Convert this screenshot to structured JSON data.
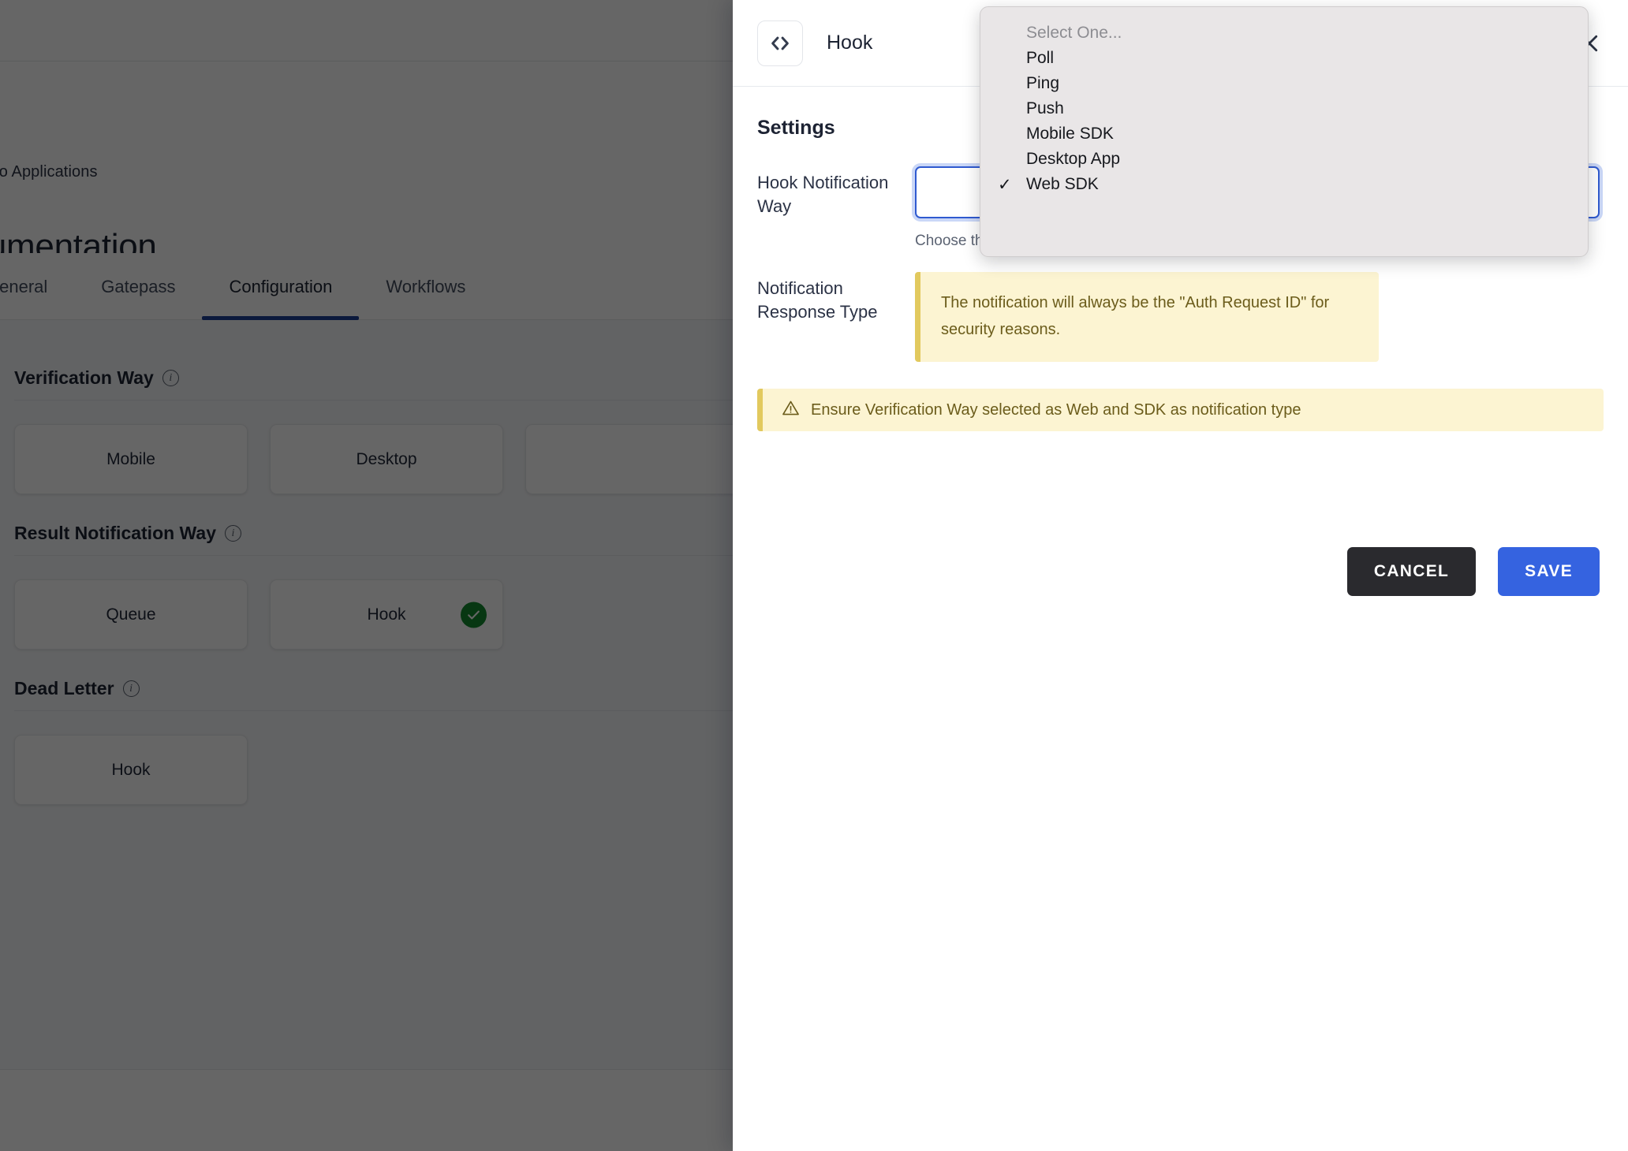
{
  "background": {
    "back_link": "ack to Applications",
    "app_title": "ocumentation",
    "tabs": [
      {
        "label": "General",
        "active": false
      },
      {
        "label": "Gatepass",
        "active": false
      },
      {
        "label": "Configuration",
        "active": true
      },
      {
        "label": "Workflows",
        "active": false
      }
    ],
    "sections": [
      {
        "title": "Verification Way",
        "info_icon": "info-icon",
        "options": [
          {
            "label": "Mobile",
            "selected": false
          },
          {
            "label": "Desktop",
            "selected": false
          },
          {
            "label": "",
            "selected": false
          }
        ]
      },
      {
        "title": "Result Notification Way",
        "info_icon": "info-icon",
        "options": [
          {
            "label": "Queue",
            "selected": false
          },
          {
            "label": "Hook",
            "selected": true
          }
        ]
      },
      {
        "title": "Dead Letter",
        "info_icon": "info-icon",
        "options": [
          {
            "label": "Hook",
            "selected": false
          }
        ]
      }
    ]
  },
  "panel": {
    "icon": "code-brackets-icon",
    "title": "Hook",
    "close_icon": "close-icon",
    "settings_heading": "Settings",
    "fields": [
      {
        "label": "Hook Notification Way",
        "control": "select",
        "value": "Web SDK",
        "help": "Choose the method for sharing the result through hook notifications."
      },
      {
        "label": "Notification Response Type",
        "control": "note",
        "note": "The notification will always be the \"Auth Request ID\" for security reasons."
      }
    ],
    "alert": {
      "icon": "warning-triangle-icon",
      "text": "Ensure Verification Way selected as Web and SDK as notification type"
    },
    "actions": {
      "cancel_label": "CANCEL",
      "save_label": "SAVE"
    }
  },
  "dropdown": {
    "open": true,
    "items": [
      {
        "label": "Select One...",
        "placeholder": true,
        "checked": false
      },
      {
        "label": "Poll",
        "placeholder": false,
        "checked": false
      },
      {
        "label": "Ping",
        "placeholder": false,
        "checked": false
      },
      {
        "label": "Push",
        "placeholder": false,
        "checked": false
      },
      {
        "label": "Mobile SDK",
        "placeholder": false,
        "checked": false
      },
      {
        "label": "Desktop App",
        "placeholder": false,
        "checked": false
      },
      {
        "label": "Web SDK",
        "placeholder": false,
        "checked": true
      }
    ],
    "check_glyph": "✓"
  },
  "colors": {
    "accent_blue": "#3563e0",
    "tab_underline": "#1d3f96",
    "note_bg": "#fcf4d2",
    "note_bar": "#e2c95e",
    "note_text": "#6b5c1b",
    "success_green": "#128a2e",
    "cancel_dark": "#2a2a2e"
  }
}
